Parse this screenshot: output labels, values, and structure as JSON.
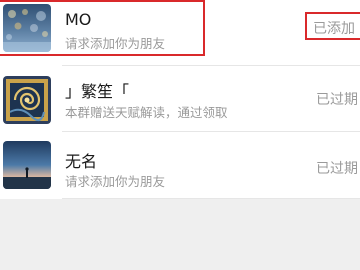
{
  "requests": [
    {
      "name": "MO",
      "message": "请求添加你为朋友",
      "status": "已添加",
      "avatar_icon": "city-lights-avatar-icon"
    },
    {
      "name": "」繁笙「",
      "message": "本群赠送天赋解读，通过领取",
      "status": "已过期",
      "avatar_icon": "swirl-painting-avatar-icon"
    },
    {
      "name": "无名",
      "message": "请求添加你为朋友",
      "status": "已过期",
      "avatar_icon": "sunset-figure-avatar-icon"
    }
  ],
  "colors": {
    "highlight": "#d9292b",
    "muted_text": "#9a9a9a",
    "background": "#efefef"
  }
}
